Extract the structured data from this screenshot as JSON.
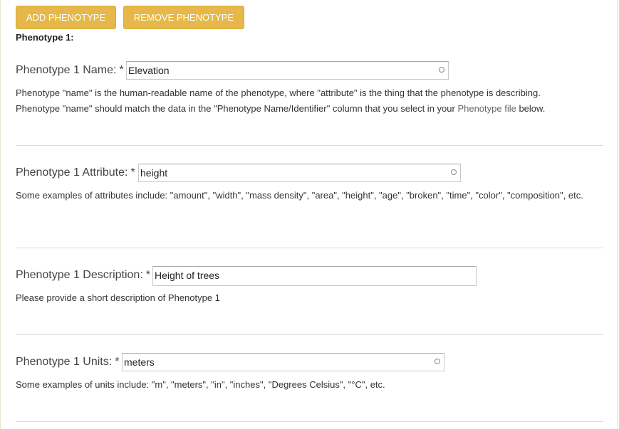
{
  "toolbar": {
    "add_label": "ADD PHENOTYPE",
    "remove_label": "REMOVE PHENOTYPE"
  },
  "section_title": "Phenotype 1:",
  "required_mark": "*",
  "fields": {
    "name": {
      "label": "Phenotype 1 Name:",
      "value": "Elevation",
      "help_line1": "Phenotype \"name\" is the human-readable name of the phenotype, where \"attribute\" is the thing that the phenotype is describing.",
      "help_line2_before": "Phenotype \"name\" should match the data in the \"Phenotype Name/Identifier\" column that you select in your ",
      "help_link": "Phenotype file",
      "help_line2_after": " below."
    },
    "attribute": {
      "label": "Phenotype 1 Attribute:",
      "value": "height",
      "help": "Some examples of attributes include: \"amount\", \"width\", \"mass density\", \"area\", \"height\", \"age\", \"broken\", \"time\", \"color\", \"composition\", etc."
    },
    "description": {
      "label": "Phenotype 1 Description:",
      "value": "Height of trees",
      "help": "Please provide a short description of Phenotype 1"
    },
    "units": {
      "label": "Phenotype 1 Units:",
      "value": "meters",
      "help": "Some examples of units include: \"m\", \"meters\", \"in\", \"inches\", \"Degrees Celsius\", \"°C\", etc."
    }
  },
  "colors": {
    "button_bg": "#e6b84a",
    "button_text": "#ffffff"
  }
}
